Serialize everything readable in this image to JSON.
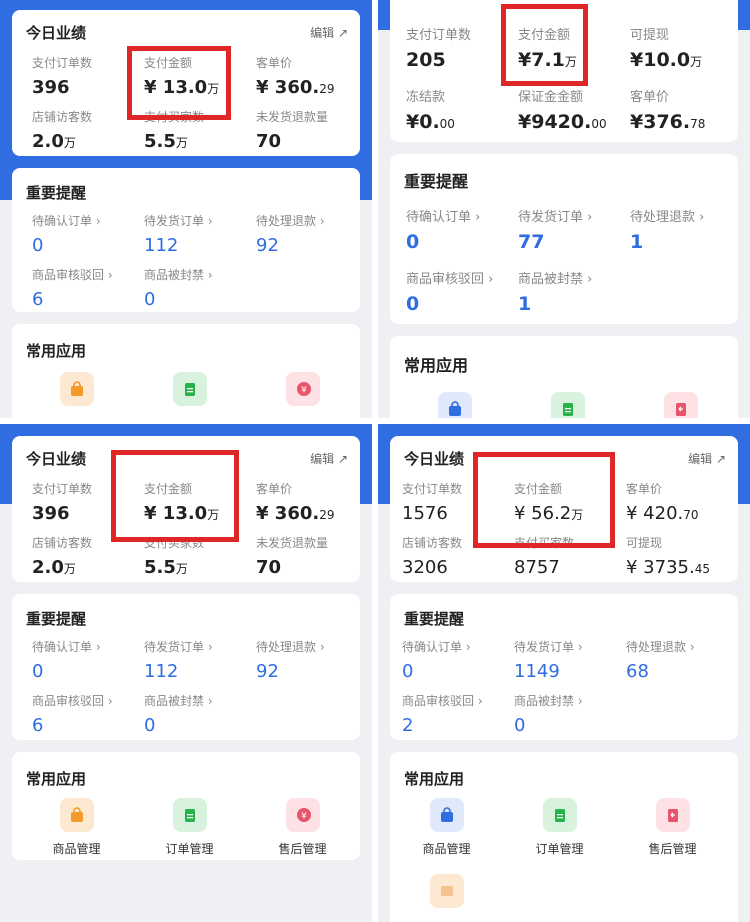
{
  "common": {
    "today": "今日业绩",
    "edit": "编辑",
    "edit_icon": "↗",
    "reminders": "重要提醒",
    "apps": "常用应用",
    "chevron": "›"
  },
  "p1": {
    "m": [
      {
        "label": "支付订单数",
        "value": "396",
        "unit": ""
      },
      {
        "label": "支付金额",
        "value": "¥ 13.0",
        "unit": "万"
      },
      {
        "label": "客单价",
        "value": "¥ 360.",
        "unit": "29"
      },
      {
        "label": "店铺访客数",
        "value": "2.0",
        "unit": "万"
      },
      {
        "label": "支付买家数",
        "value": "5.5",
        "unit": "万"
      },
      {
        "label": "未发货退款量",
        "value": "70",
        "unit": ""
      }
    ],
    "r": [
      {
        "label": "待确认订单",
        "value": "0"
      },
      {
        "label": "待发货订单",
        "value": "112"
      },
      {
        "label": "待处理退款",
        "value": "92"
      },
      {
        "label": "商品审核驳回",
        "value": "6"
      },
      {
        "label": "商品被封禁",
        "value": "0"
      }
    ],
    "a": [
      {
        "label": "商品管理",
        "icon": "bag-icon"
      },
      {
        "label": "订单管理",
        "icon": "order-icon"
      },
      {
        "label": "售后管理",
        "icon": "refund-icon"
      }
    ]
  },
  "p2": {
    "m": [
      {
        "label": "支付订单数",
        "value": "205",
        "unit": ""
      },
      {
        "label": "支付金额",
        "value": "¥7.1",
        "unit": "万"
      },
      {
        "label": "可提现",
        "value": "¥10.0",
        "unit": "万"
      },
      {
        "label": "冻结款",
        "value": "¥0.",
        "unit": "00"
      },
      {
        "label": "保证金金额",
        "value": "¥9420.",
        "unit": "00"
      },
      {
        "label": "客单价",
        "value": "¥376.",
        "unit": "78"
      }
    ],
    "r": [
      {
        "label": "待确认订单",
        "value": "0"
      },
      {
        "label": "待发货订单",
        "value": "77"
      },
      {
        "label": "待处理退款",
        "value": "1"
      },
      {
        "label": "商品审核驳回",
        "value": "0"
      },
      {
        "label": "商品被封禁",
        "value": "1"
      }
    ]
  },
  "p3": {
    "m": [
      {
        "label": "支付订单数",
        "value": "396",
        "unit": ""
      },
      {
        "label": "支付金额",
        "value": "¥ 13.0",
        "unit": "万"
      },
      {
        "label": "客单价",
        "value": "¥ 360.",
        "unit": "29"
      },
      {
        "label": "店铺访客数",
        "value": "2.0",
        "unit": "万"
      },
      {
        "label": "支付买家数",
        "value": "5.5",
        "unit": "万"
      },
      {
        "label": "未发货退款量",
        "value": "70",
        "unit": ""
      }
    ],
    "r": [
      {
        "label": "待确认订单",
        "value": "0"
      },
      {
        "label": "待发货订单",
        "value": "112"
      },
      {
        "label": "待处理退款",
        "value": "92"
      },
      {
        "label": "商品审核驳回",
        "value": "6"
      },
      {
        "label": "商品被封禁",
        "value": "0"
      }
    ],
    "a": [
      {
        "label": "商品管理",
        "icon": "bag-icon"
      },
      {
        "label": "订单管理",
        "icon": "order-icon"
      },
      {
        "label": "售后管理",
        "icon": "refund-icon"
      }
    ]
  },
  "p4": {
    "m": [
      {
        "label": "支付订单数",
        "value": "1576",
        "unit": ""
      },
      {
        "label": "支付金额",
        "value": "¥ 56.2",
        "unit": "万"
      },
      {
        "label": "客单价",
        "value": "¥ 420.",
        "unit": "70"
      },
      {
        "label": "店铺访客数",
        "value": "3206",
        "unit": ""
      },
      {
        "label": "支付买家数",
        "value": "8757",
        "unit": ""
      },
      {
        "label": "可提现",
        "value": "¥ 3735.",
        "unit": "45"
      }
    ],
    "r": [
      {
        "label": "待确认订单",
        "value": "0"
      },
      {
        "label": "待发货订单",
        "value": "1149"
      },
      {
        "label": "待处理退款",
        "value": "68"
      },
      {
        "label": "商品审核驳回",
        "value": "2"
      },
      {
        "label": "商品被封禁",
        "value": "0"
      }
    ],
    "a": [
      {
        "label": "商品管理",
        "icon": "bag-icon"
      },
      {
        "label": "订单管理",
        "icon": "order-icon"
      },
      {
        "label": "售后管理",
        "icon": "refund-icon"
      }
    ]
  },
  "colors": {
    "accent": "#2f6de0",
    "highlight": "#e02626",
    "orange": "#f39a2b",
    "green": "#27b34b",
    "pink": "#e8556b",
    "peach": "#f4c28f"
  }
}
